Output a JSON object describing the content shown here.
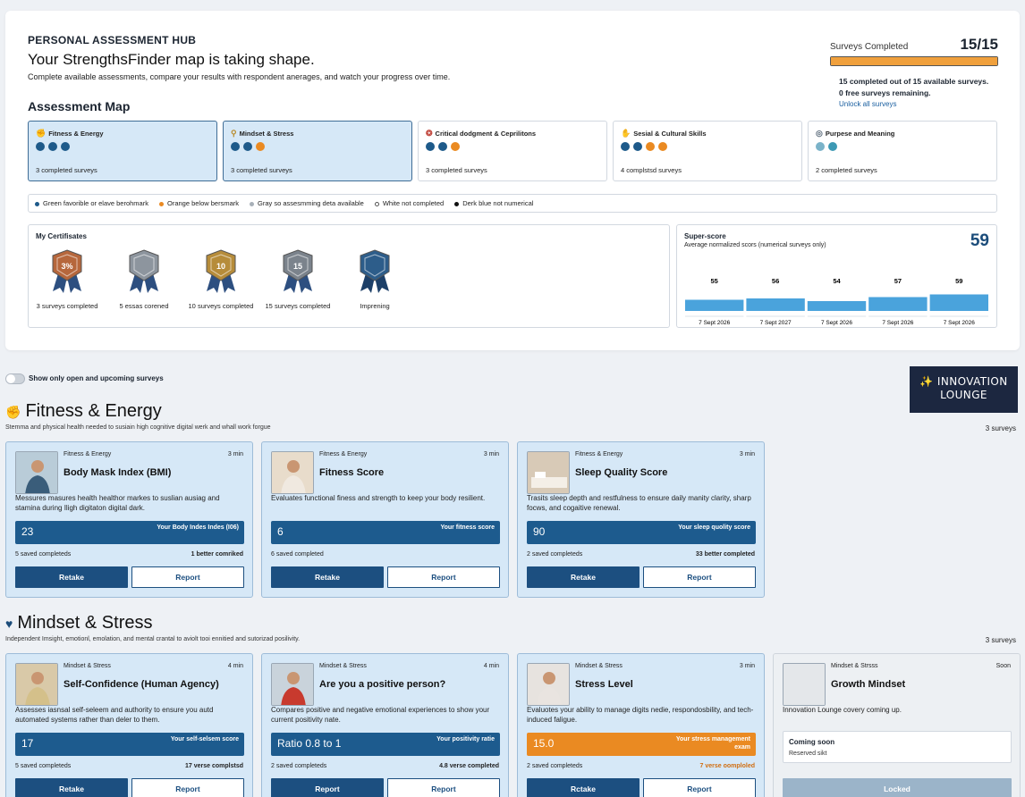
{
  "hub": {
    "eyebrow": "PERSONAL ASSESSMENT HUB",
    "title": "Your StrengthsFinder map is taking shape.",
    "description": "Complete available assessments, compare your results with respondent anerages, and watch your progress over time.",
    "map_title": "Assessment Map"
  },
  "progress": {
    "label": "Surveys Completed",
    "count": "15/15",
    "fraction": 1.0,
    "line1": "15 completed out of 15 available surveys.",
    "line2": "0 free surveys remaining.",
    "link": "Unlock all surveys"
  },
  "categories": [
    {
      "name": "Fitness & Energy",
      "icon": "muscle-icon",
      "count": "3 completed surveys",
      "dots": [
        "#1e5a8a",
        "#1e5a8a",
        "#1e5a8a"
      ],
      "selected": true
    },
    {
      "name": "Mindset & Stress",
      "icon": "mind-icon",
      "count": "3 completed surveys",
      "dots": [
        "#1e5a8a",
        "#1e5a8a",
        "#ea8a22"
      ],
      "selected": true
    },
    {
      "name": "Critical dodgment & Ceprilitons",
      "icon": "brain-icon",
      "count": "3 completed surveys",
      "dots": [
        "#1e5a8a",
        "#1e5a8a",
        "#ea8a22"
      ],
      "selected": false
    },
    {
      "name": "Sesial & Cultural Skills",
      "icon": "handshake-icon",
      "count": "4 complstsd surveys",
      "dots": [
        "#1e5a8a",
        "#1e5a8a",
        "#ea8a22",
        "#ea8a22"
      ],
      "selected": false
    },
    {
      "name": "Purpese and Meaning",
      "icon": "compass-icon",
      "count": "2 completed surveys",
      "dots": [
        "#7bb3c9",
        "#3d99b4"
      ],
      "selected": false
    }
  ],
  "legend": [
    {
      "label": "Green favorible or elave berohmark",
      "color": "#1e5a8a",
      "hollow": false
    },
    {
      "label": "Orange below bersmark",
      "color": "#ea8a22",
      "hollow": false
    },
    {
      "label": "Gray so assesmming deta available",
      "color": "#a8b0b8",
      "hollow": false
    },
    {
      "label": "White not completed",
      "color": "#ffffff",
      "hollow": true
    },
    {
      "label": "Derk blue not numerical",
      "color": "#111111",
      "hollow": false
    }
  ],
  "certificates": {
    "title": "My Certifisates",
    "items": [
      {
        "label": "3 surveys completed",
        "badge": "3%",
        "color": "#b6673c"
      },
      {
        "label": "5 essas corened",
        "badge": "",
        "color": "#8d959e"
      },
      {
        "label": "10 surveys completed",
        "badge": "10",
        "color": "#b68c3a"
      },
      {
        "label": "15 surveys completed",
        "badge": "15",
        "color": "#7b838c"
      },
      {
        "label": "Imprening",
        "badge": "",
        "color": "#2d5d8a"
      }
    ]
  },
  "superscore": {
    "title": "Super-score",
    "subtitle": "Average normalized scors (numerical surveys only)",
    "value": "59"
  },
  "chart_data": {
    "type": "bar",
    "categories": [
      "7 Sept 2026",
      "7 Sept 2027",
      "7 Sept 2026",
      "7 Sept 2026",
      "7 Sept 2026"
    ],
    "values": [
      55,
      56,
      54,
      57,
      59
    ],
    "ylim": [
      50,
      62
    ],
    "color": "#4aa3dc"
  },
  "toggle": {
    "label": "Show only open and upcoming surveys"
  },
  "lounge": {
    "line1": "✨ INNOVATION",
    "line2": "LOUNGE"
  },
  "sections": [
    {
      "title": "Fitness & Energy",
      "icon": "muscle-icon",
      "description": "Stemma and physical health needed to susiain high cognitive digital werk and whall work forgue",
      "count": "3 surveys",
      "cards": [
        {
          "category": "Fitness & Energy",
          "time": "3 min",
          "title": "Body Mask Index (BMI)",
          "description": "Messures masures health healthor markes to suslian ausiag and stamina during Iligh digitaton digital dark.",
          "score": "23",
          "score_label": "Your Body Indes Indes (I06)",
          "saved": "5 saved completeds",
          "better": "1 better comriked",
          "primary": "Retake",
          "secondary": "Report",
          "variant": "blue",
          "thumb": "person-icon"
        },
        {
          "category": "Fitness & Energy",
          "time": "3 min",
          "title": "Fitness Score",
          "description": "Evaluates functional finess and strength to keep your body resilient.",
          "score": "6",
          "score_label": "Your fitness score",
          "saved": "6 saved completed",
          "better": "",
          "primary": "Retake",
          "secondary": "Report",
          "variant": "blue",
          "thumb": "person-icon"
        },
        {
          "category": "Fitness & Energy",
          "time": "3 min",
          "title": "Sleep Quality Score",
          "description": "Trasits sleep depth and restfulness to ensure daily manity clarity, sharp focws, and cogaitive renewal.",
          "score": "90",
          "score_label": "Your sleep quolity score",
          "saved": "2 saved completeds",
          "better": "33 better completed",
          "primary": "Retake",
          "secondary": "Report",
          "variant": "blue",
          "thumb": "bed-icon"
        }
      ]
    },
    {
      "title": "Mindset & Stress",
      "icon": "mind-icon",
      "description": "Independent Imsight, emotionl, emolation, and mental crantal to aviolt tooi ennitied and sutorizad posilivity.",
      "count": "3 surveys",
      "cards": [
        {
          "category": "Mindset & Stress",
          "time": "4 min",
          "title": "Self-Confidence (Human Agency)",
          "description": "Assesses iasnsal self-seleem and authority to ensure you autd automated systems rather than deler to them.",
          "score": "17",
          "score_label": "Your self-selsem score",
          "saved": "5 saved completeds",
          "better": "17 verse complstsd",
          "primary": "Retake",
          "secondary": "Report",
          "variant": "blue",
          "thumb": "person-icon"
        },
        {
          "category": "Mindset & Stress",
          "time": "4 min",
          "title": "Are you a positive person?",
          "description": "Compares positive and negative emotional experiences to show your current positivity nate.",
          "score": "Ratio 0.8 to 1",
          "score_label": "Your positivity ratie",
          "saved": "2 saved completeds",
          "better": "4.8 verse completed",
          "primary": "Report",
          "secondary": "Report",
          "variant": "blue",
          "thumb": "person-icon"
        },
        {
          "category": "Mindset & Stress",
          "time": "3 min",
          "title": "Stress Level",
          "description": "Evaluotes your ability to manage digits nedie, respondosbility, and tech-induced faligue.",
          "score": "15.0",
          "score_label": "Your stress management exam",
          "saved": "2 saved completeds",
          "better": "7 verse oomploled",
          "primary": "Rctake",
          "secondary": "Report",
          "variant": "orange",
          "thumb": "person-icon"
        },
        {
          "category": "Mindset & Strsss",
          "time": "Soon",
          "title": "Growth Mindset",
          "description": "Innovation Lounge covery coming up.",
          "soon_title": "Coming soon",
          "soon_sub": "Reserved sikt",
          "locked": "Locked",
          "variant": "soon",
          "thumb": "placeholder-icon"
        }
      ]
    }
  ]
}
